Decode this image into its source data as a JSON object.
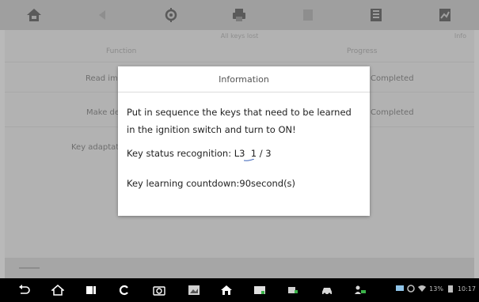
{
  "toolbar": {
    "icons": [
      "home-icon",
      "back-icon",
      "settings-icon",
      "print-icon",
      "help-icon",
      "save-icon",
      "data-icon"
    ]
  },
  "screen": {
    "subtitle": "All keys lost",
    "corner_text": "Info",
    "table": {
      "col_function": "Function",
      "col_progress": "Progress",
      "rows": [
        {
          "label": "Read immo data",
          "status": "Completed"
        },
        {
          "label": "Make dealer key",
          "status": "Completed"
        },
        {
          "label": "Key adaptation",
          "status": ""
        }
      ]
    }
  },
  "dialog": {
    "title": "Information",
    "line1": "Put in sequence the keys that need to be learned",
    "line2": "in the ignition switch and turn to ON!",
    "key_status": "Key status recognition: L3  1 / 3",
    "countdown": "Key learning countdown:90second(s)"
  },
  "sysbar": {
    "battery": "13%",
    "time": "10:17"
  },
  "colors": {
    "sysbar_bg": "#000000",
    "dialog_bg": "#ffffff",
    "overlay": "#b2b2b2",
    "underline": "#3a63b8"
  }
}
